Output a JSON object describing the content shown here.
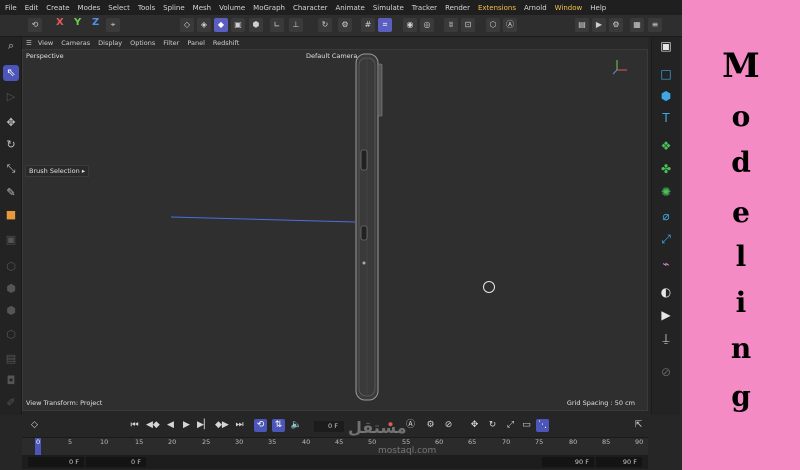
{
  "menubar": [
    "File",
    "Edit",
    "Create",
    "Modes",
    "Select",
    "Tools",
    "Spline",
    "Mesh",
    "Volume",
    "MoGraph",
    "Character",
    "Animate",
    "Simulate",
    "Tracker",
    "Render",
    "Extensions",
    "Arnold",
    "Window",
    "Help"
  ],
  "toolbar": {
    "axis_x": "X",
    "axis_y": "Y",
    "axis_z": "Z"
  },
  "viewport_menu": [
    "View",
    "Cameras",
    "Display",
    "Options",
    "Filter",
    "Panel",
    "Redshift"
  ],
  "viewport": {
    "projection": "Perspective",
    "camera": "Default Camera",
    "brush_label": "Brush Selection",
    "view_transform": "View Transform: Project",
    "grid_spacing": "Grid Spacing : 50 cm"
  },
  "timeline": {
    "current_frame": "0 F",
    "ruler_ticks": [
      "0",
      "5",
      "10",
      "15",
      "20",
      "25",
      "30",
      "35",
      "40",
      "45",
      "50",
      "55",
      "60",
      "65",
      "70",
      "75",
      "80",
      "85",
      "90"
    ],
    "range_start": "0 F",
    "range_start2": "0 F",
    "range_end": "90 F",
    "range_end2": "90 F"
  },
  "watermark": {
    "main": "مستقل",
    "sub": "mostaql.com"
  },
  "side_title": {
    "letters": [
      "M",
      "o",
      "d",
      "e",
      "l",
      "i",
      "n",
      "g"
    ]
  },
  "colors": {
    "accent": "#4c56b8",
    "panel": "#f48bc4"
  }
}
